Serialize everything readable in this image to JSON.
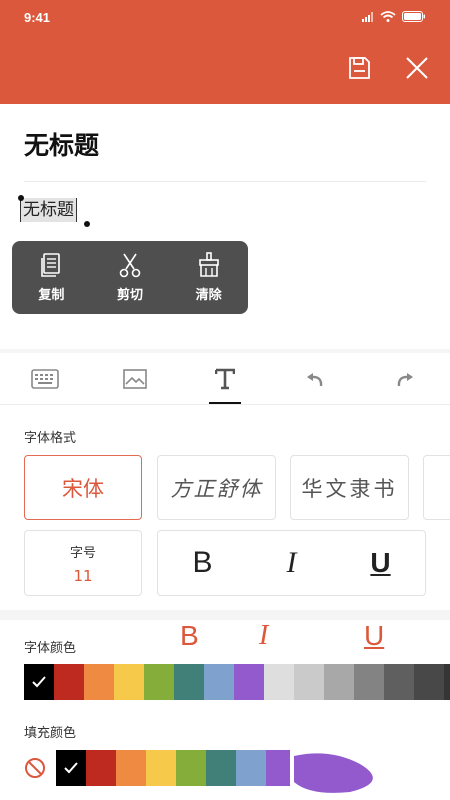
{
  "status": {
    "time": "9:41"
  },
  "header": {
    "save_icon": "save-icon",
    "close_icon": "close-icon"
  },
  "document": {
    "title": "无标题",
    "body_text": "无标题"
  },
  "context_menu": {
    "copy": "复制",
    "cut": "剪切",
    "clear": "清除"
  },
  "tabs": [
    "keyboard-icon",
    "image-icon",
    "text-format-icon",
    "undo-icon",
    "redo-icon"
  ],
  "font_format": {
    "label": "字体格式",
    "fonts": [
      "宋体",
      "方正舒体",
      "华文隶书"
    ],
    "selected": "宋体"
  },
  "font_size": {
    "label": "字号",
    "value": "11"
  },
  "styles": {
    "bold": "B",
    "italic": "I",
    "underline": "U"
  },
  "font_color": {
    "label": "字体颜色",
    "selected": "#000000",
    "colors": [
      "#000000",
      "#be2a20",
      "#ef8a43",
      "#f6c94a",
      "#84ad3a",
      "#408078",
      "#7ea1ce",
      "#925acd",
      "#dedede",
      "#cacaca",
      "#a8a8a8",
      "#838383",
      "#5f5f5f",
      "#484848",
      "#353535"
    ]
  },
  "fill_color": {
    "label": "填充颜色",
    "selected": "#000000",
    "colors": [
      "#000000",
      "#be2a20",
      "#ef8a43",
      "#f6c94a",
      "#84ad3a",
      "#408078",
      "#7ea1ce",
      "#925acd"
    ]
  },
  "accent": "#dc583c"
}
